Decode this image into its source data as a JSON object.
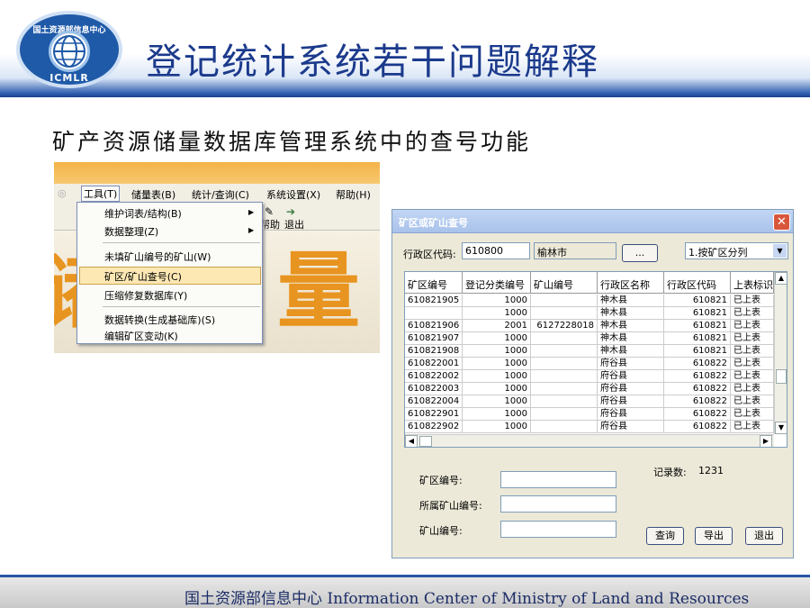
{
  "header": {
    "title": "登记统计系统若干问题解释",
    "logo_text_top": "国土资源部信息中心",
    "logo_text_bottom": "ICMLR"
  },
  "subtitle": "矿产资源储量数据库管理系统中的查号功能",
  "menu_screenshot": {
    "menubar": [
      "工具(T)",
      "储量表(B)",
      "统计/查询(C)",
      "系统设置(X)",
      "帮助(H)"
    ],
    "toolbar": {
      "help": "帮助",
      "exit": "退出"
    },
    "dropdown_items": [
      "维护词表/结构(B)",
      "数据整理(Z)",
      "未填矿山编号的矿山(W)",
      "矿区/矿山查号(C)",
      "压缩修复数据库(Y)",
      "数据转换(生成基础库)(S)",
      "编辑矿区变动(K)"
    ],
    "background_chars": [
      "储",
      "量"
    ]
  },
  "dialog": {
    "title": "矿区或矿山查号",
    "region_code_label": "行政区代码:",
    "region_code_value": "610800",
    "region_name_value": "榆林市",
    "browse_button": "...",
    "sort_select": "1.按矿区分列",
    "table": {
      "headers": [
        "矿区编号",
        "登记分类编号",
        "矿山编号",
        "行政区名称",
        "行政区代码",
        "上表标识"
      ],
      "rows": [
        [
          "610821905",
          "1000",
          "",
          "神木县",
          "610821",
          "已上表"
        ],
        [
          "",
          "1000",
          "",
          "神木县",
          "610821",
          "已上表"
        ],
        [
          "610821906",
          "2001",
          "6127228018",
          "神木县",
          "610821",
          "已上表"
        ],
        [
          "610821907",
          "1000",
          "",
          "神木县",
          "610821",
          "已上表"
        ],
        [
          "610821908",
          "1000",
          "",
          "神木县",
          "610821",
          "已上表"
        ],
        [
          "610822001",
          "1000",
          "",
          "府谷县",
          "610822",
          "已上表"
        ],
        [
          "610822002",
          "1000",
          "",
          "府谷县",
          "610822",
          "已上表"
        ],
        [
          "610822003",
          "1000",
          "",
          "府谷县",
          "610822",
          "已上表"
        ],
        [
          "610822004",
          "1000",
          "",
          "府谷县",
          "610822",
          "已上表"
        ],
        [
          "610822901",
          "1000",
          "",
          "府谷县",
          "610822",
          "已上表"
        ],
        [
          "610822902",
          "1000",
          "",
          "府谷县",
          "610822",
          "已上表"
        ]
      ]
    },
    "form": {
      "mine_area_label": "矿区编号:",
      "parent_mine_label": "所属矿山编号:",
      "mine_label": "矿山编号:"
    },
    "record_label": "记录数:",
    "record_count": "1231",
    "buttons": {
      "query": "查询",
      "export": "导出",
      "exit": "退出"
    }
  },
  "footer": "国土资源部信息中心  Information Center of Ministry of Land and Resources"
}
